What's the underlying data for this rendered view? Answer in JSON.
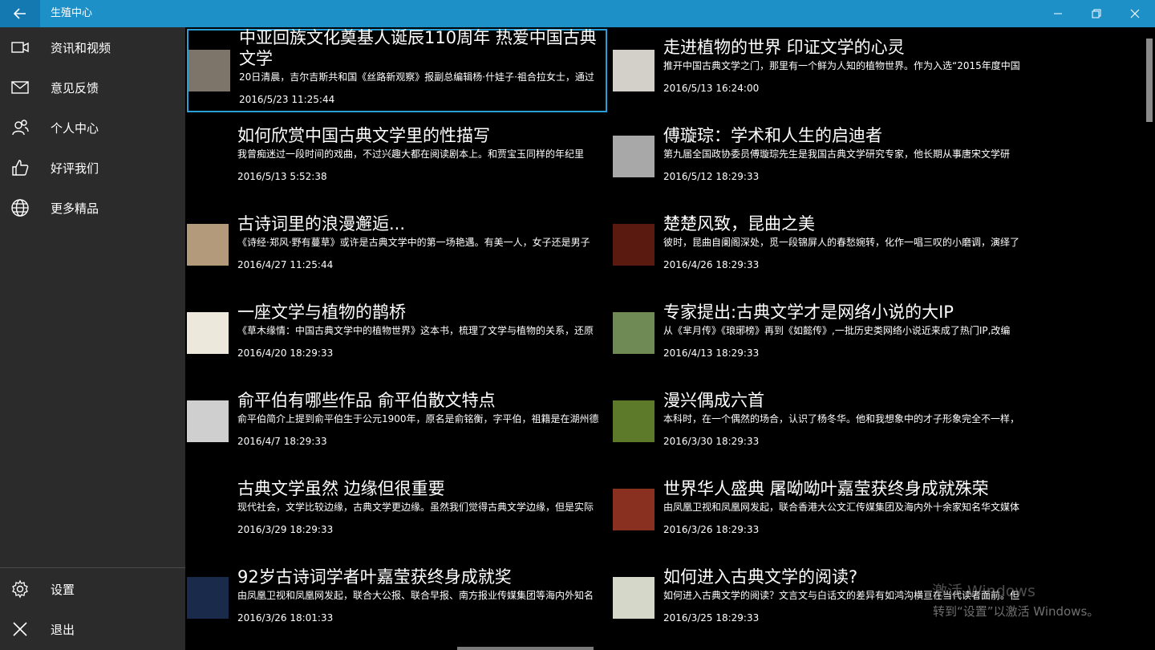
{
  "app": {
    "title": "生殖中心"
  },
  "sidebar": {
    "items": [
      {
        "label": "资讯和视频",
        "icon": "video-icon"
      },
      {
        "label": "意见反馈",
        "icon": "mail-icon"
      },
      {
        "label": "个人中心",
        "icon": "people-icon"
      },
      {
        "label": "好评我们",
        "icon": "thumbs-up-icon"
      },
      {
        "label": "更多精品",
        "icon": "globe-icon"
      }
    ],
    "bottom": [
      {
        "label": "设置",
        "icon": "gear-icon"
      },
      {
        "label": "退出",
        "icon": "close-icon"
      }
    ]
  },
  "articles": [
    {
      "title": "中亚回族文化奠基人诞辰110周年 热爱中国古典文学",
      "summary": "20日清晨，吉尔吉斯共和国《丝路新观察》报副总编辑杨·什娃子·祖合拉女士，通过",
      "date": "2016/5/23 11:25:44",
      "thumb": "#7d756a"
    },
    {
      "title": "走进植物的世界 印证文学的心灵",
      "summary": "推开中国古典文学之门，那里有一个鲜为人知的植物世界。作为入选“2015年度中国",
      "date": "2016/5/13 16:24:00",
      "thumb": "#d2d0c8"
    },
    {
      "title": "如何欣赏中国古典文学里的性描写",
      "summary": "我曾痴迷过一段时间的戏曲，不过兴趣大都在阅读剧本上。和贾宝玉同样的年纪里",
      "date": "2016/5/13 5:52:38",
      "thumb": ""
    },
    {
      "title": "傅璇琮：学术和人生的启迪者",
      "summary": "第九届全国政协委员傅璇琮先生是我国古典文学研究专家，他长期从事唐宋文学研",
      "date": "2016/5/12 18:29:33",
      "thumb": "#a8a8a8"
    },
    {
      "title": "古诗词里的浪漫邂逅...",
      "summary": "《诗经·郑风·野有蔓草》或许是古典文学中的第一场艳遇。有美一人，女子还是男子",
      "date": "2016/4/27 11:25:44",
      "thumb": "#b29a7a"
    },
    {
      "title": "楚楚风致，昆曲之美",
      "summary": "彼时，昆曲自阑阁深处，觅一段锦屏人的春愁婉转，化作一唱三叹的小磨调，演绎了",
      "date": "2016/4/26 18:29:33",
      "thumb": "#5a1a10"
    },
    {
      "title": "一座文学与植物的鹊桥",
      "summary": "《草木缘情：中国古典文学中的植物世界》这本书，梳理了文学与植物的关系，还原",
      "date": "2016/4/20 18:29:33",
      "thumb": "#ece9dc"
    },
    {
      "title": "专家提出:古典文学才是网络小说的大IP",
      "summary": "从《芈月传》《琅琊榜》再到《如懿传》,一批历史类网络小说近来成了热门IP,改编",
      "date": "2016/4/13 18:29:33",
      "thumb": "#6f8a55"
    },
    {
      "title": "俞平伯有哪些作品 俞平伯散文特点",
      "summary": "俞平伯简介上提到俞平伯生于公元1900年，原名是俞铭衡，字平伯，祖籍是在湖州德",
      "date": "2016/4/7 18:29:33",
      "thumb": "#cfcfcf"
    },
    {
      "title": "漫兴偶成六首",
      "summary": "本科时，在一个偶然的场合，认识了杨冬华。他和我想象中的才子形象完全不一样，",
      "date": "2016/3/30 18:29:33",
      "thumb": "#5c7a2a"
    },
    {
      "title": "古典文学虽然 边缘但很重要",
      "summary": "现代社会，文学比较边缘，古典文学更边缘。虽然我们觉得古典文学边缘，但是实际",
      "date": "2016/3/29 18:29:33",
      "thumb": ""
    },
    {
      "title": "世界华人盛典 屠呦呦叶嘉莹获终身成就殊荣",
      "summary": "由凤凰卫视和凤凰网发起，联合香港大公文汇传媒集团及海内外十余家知名华文媒体",
      "date": "2016/3/26 18:29:33",
      "thumb": "#8a3020"
    },
    {
      "title": "92岁古诗词学者叶嘉莹获终身成就奖",
      "summary": "由凤凰卫视和凤凰网发起，联合大公报、联合早报、南方报业传媒集团等海内外知名",
      "date": "2016/3/26 18:01:33",
      "thumb": "#1a2a4a"
    },
    {
      "title": "如何进入古典文学的阅读?",
      "summary": "如何进入古典文学的阅读？文言文与白话文的差异有如鸿沟横亘在当代读者面前。但",
      "date": "2016/3/25 18:29:33",
      "thumb": "#d5d8c8"
    }
  ],
  "watermark": {
    "line1": "激活 Windows",
    "line2": "转到“设置”以激活 Windows。"
  }
}
